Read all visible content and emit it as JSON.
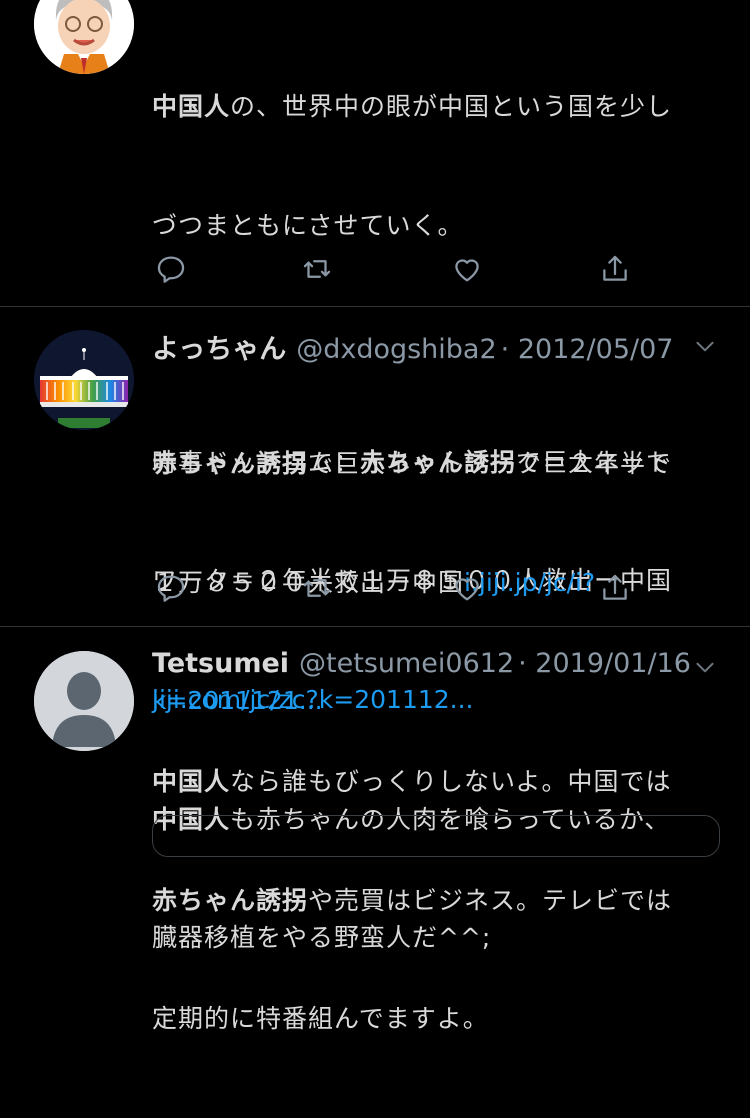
{
  "tweets": [
    {
      "text_lines": [
        [
          "_b:中国人",
          "の、世界中の眼が中国という国を少し"
        ],
        [
          "づつまともにさせていく。"
        ],
        [
          ""
        ],
        [
          "時事ドットコム：",
          "_b:赤ちゃん誘拐",
          "で巨大ネット"
        ],
        [
          "ワーク＝２年半で１万８５００人救出ー中国"
        ]
      ],
      "link": "jiji.com/jc/zc?k=201112..."
    },
    {
      "name": "よっちゃん",
      "handle": "@dxdogshiba2",
      "date": "· 2012/05/07",
      "line1_bold": "赤ちゃん誘拐",
      "line1_rest": "で巨大ネットワーク＝２年半で",
      "line2_text": "１万８５００人救出ー中国",
      "line2_link": "i.jiji.jp/jc/i?",
      "line3_link": "k=2011121...",
      "line4_bold": "中国人",
      "line4_rest": "も赤ちゃんの人肉を喰らっているか、",
      "line5": "臓器移植をやる野蛮人だ^^;"
    },
    {
      "name": "Tetsumei",
      "handle": "@tetsumei0612",
      "date": "· 2019/01/16",
      "line1_bold": "中国人",
      "line1_rest": "なら誰もびっくりしないよ。中国では",
      "line2_bold": "赤ちゃん誘拐",
      "line2_rest": "や売買はビジネス。テレビでは",
      "line3": "定期的に特番組んでますよ。"
    }
  ],
  "icons": {
    "reply": "reply-icon",
    "retweet": "retweet-icon",
    "like": "heart-icon",
    "share": "share-icon",
    "caret": "chevron-down-icon"
  },
  "colors": {
    "link": "#1d9bf0",
    "meta": "#8b98a5",
    "divider": "#2f3336",
    "background": "#000000"
  }
}
